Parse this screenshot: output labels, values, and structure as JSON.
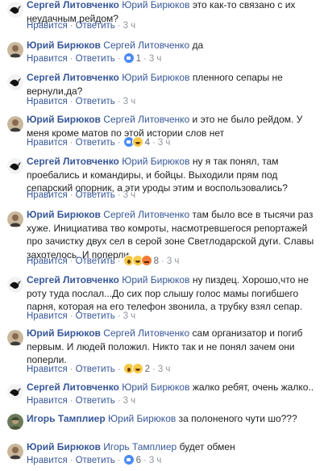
{
  "labels": {
    "like": "Нравится",
    "reply": "Ответить",
    "sep": "·"
  },
  "comments": [
    {
      "author": "Сергей Литовченко",
      "mention": "Юрий Бирюков",
      "text": "это как-то связано с их неудачным рейдом?",
      "avatar_icon": "eagle-avatar",
      "reactions": [],
      "reaction_count": "",
      "time": "3 ч"
    },
    {
      "author": "Юрий Бирюков",
      "mention": "Сергей Литовченко",
      "text": "да",
      "avatar_icon": "man-avatar",
      "reactions": [
        "like"
      ],
      "reaction_count": "1",
      "time": "3 ч"
    },
    {
      "author": "Сергей Литовченко",
      "mention": "Юрий Бирюков",
      "text": "пленного сепары не вернули,да?",
      "avatar_icon": "eagle-avatar",
      "reactions": [],
      "reaction_count": "",
      "time": "3 ч"
    },
    {
      "author": "Юрий Бирюков",
      "mention": "Сергей Литовченко",
      "text": "и это не было рейдом. У меня кроме матов по этой истории слов нет",
      "avatar_icon": "man-avatar",
      "reactions": [
        "like",
        "laugh"
      ],
      "reaction_count": "4",
      "time": "3 ч"
    },
    {
      "author": "Сергей Литовченко",
      "mention": "Юрий Бирюков",
      "text": "ну я так понял, там проебались и командиры, и бойцы. Выходили прям под сепарский опорник, а эти уроды этим и воспользовались?",
      "avatar_icon": "eagle-avatar",
      "reactions": [],
      "reaction_count": "",
      "time": "3 ч"
    },
    {
      "author": "Юрий Бирюков",
      "mention": "Сергей Литовченко",
      "text": "там было все в тысячи раз хуже. Инициатива тво комроты, насмотревшегося репортажей про зачистку двух сел в серой зоне Светлодарской дуги. Славы захотелось. И поперли.",
      "avatar_icon": "man-avatar",
      "reactions": [
        "wow",
        "laugh",
        "angry"
      ],
      "reaction_count": "8",
      "time": "3 ч"
    },
    {
      "author": "Сергей Литовченко",
      "mention": "Юрий Бирюков",
      "text": "ну пиздец. Хорошо,что не роту туда послал...До сих пор слышу голос мамы погибшего парня, которая на его телефон звонила, а трубку взял сепар.",
      "avatar_icon": "eagle-avatar",
      "reactions": [],
      "reaction_count": "",
      "time": "3 ч"
    },
    {
      "author": "Юрий Бирюков",
      "mention": "Сергей Литовченко",
      "text": "сам организатор и погиб первым. И людей положил. Никто так и не понял зачем они поперли.",
      "avatar_icon": "man-avatar",
      "reactions": [
        "wow",
        "laugh"
      ],
      "reaction_count": "2",
      "time": "3 ч"
    },
    {
      "author": "Сергей Литовченко",
      "mention": "Юрий Бирюков",
      "text": "жалко ребят, очень жалко..",
      "avatar_icon": "eagle-avatar",
      "reactions": [],
      "reaction_count": "",
      "time": "3 ч"
    },
    {
      "author": "Игорь Тамплиер",
      "mention": "Юрий Бирюков",
      "text": "за полоненого чути шо???",
      "avatar_icon": "soldier-avatar",
      "reactions": [],
      "reaction_count": "",
      "time": "",
      "no_actions": true
    },
    {
      "author": "Юрий Бирюков",
      "mention": "Игорь Тамплиер",
      "text": "будет обмен",
      "avatar_icon": "man-avatar",
      "reactions": [
        "like"
      ],
      "reaction_count": "6",
      "time": "3 ч"
    }
  ]
}
